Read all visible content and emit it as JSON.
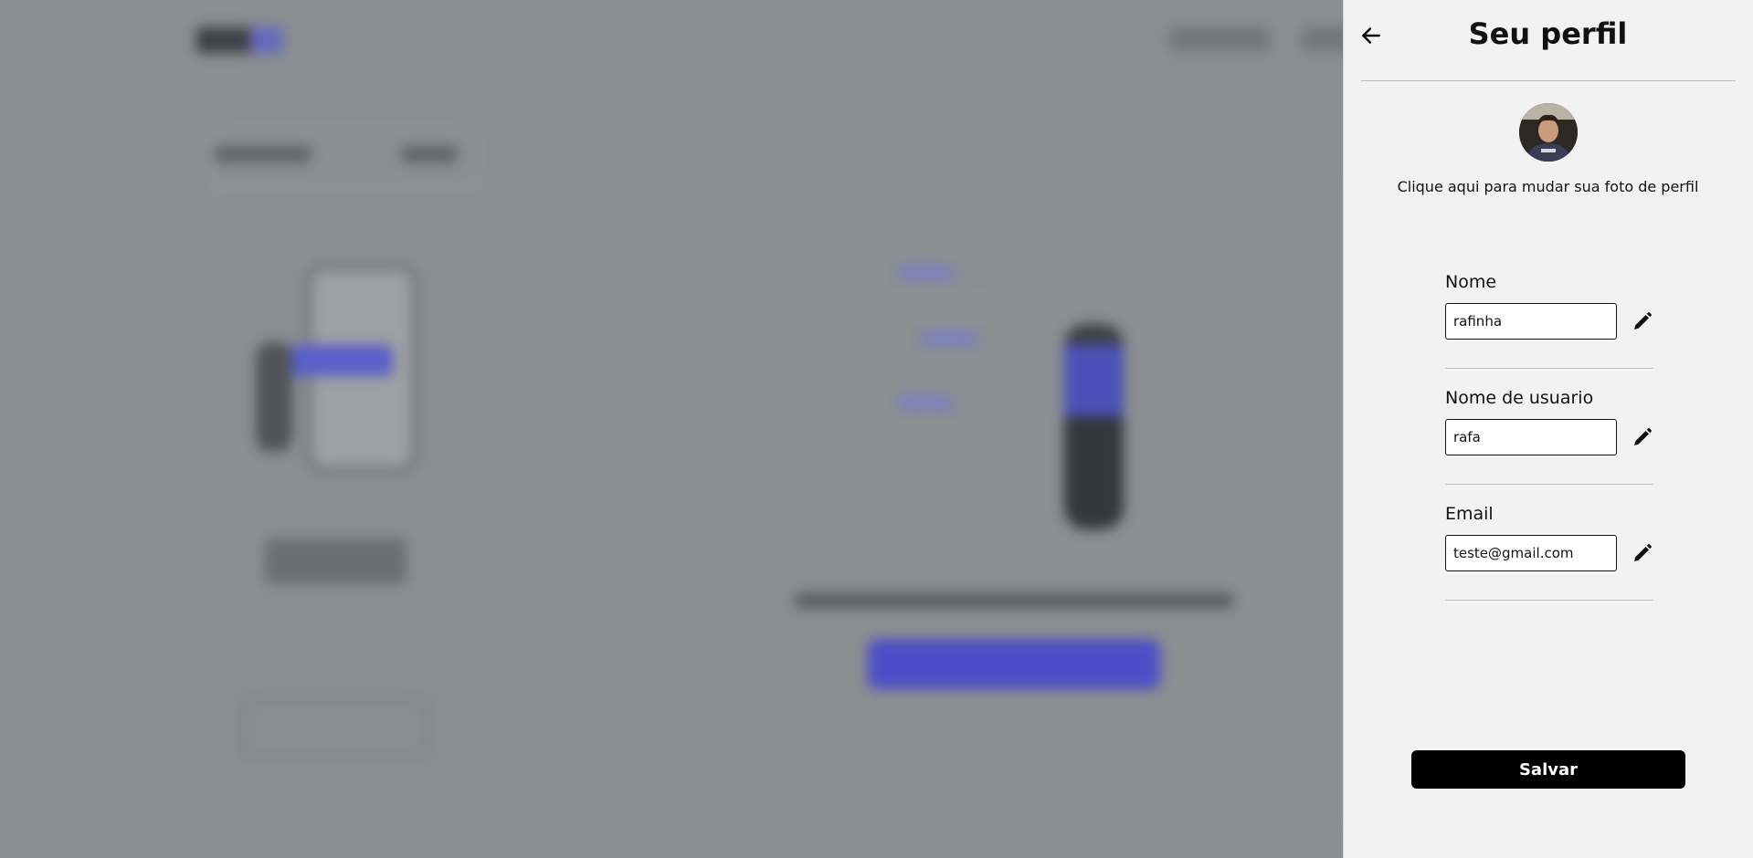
{
  "panel": {
    "title": "Seu perfil",
    "avatar_hint": "Clique aqui para mudar sua foto de perfil",
    "fields": [
      {
        "label": "Nome",
        "value": "rafinha"
      },
      {
        "label": "Nome de usuario",
        "value": "rafa"
      },
      {
        "label": "Email",
        "value": "teste@gmail.com"
      }
    ],
    "save_label": "Salvar"
  },
  "icons": {
    "back": "arrow-left-icon",
    "edit": "pencil-icon"
  },
  "colors": {
    "panel_bg": "#f2f2f2",
    "overlay": "#8a8f92",
    "accent": "#5a5fc9",
    "primary_button": "#000000"
  }
}
